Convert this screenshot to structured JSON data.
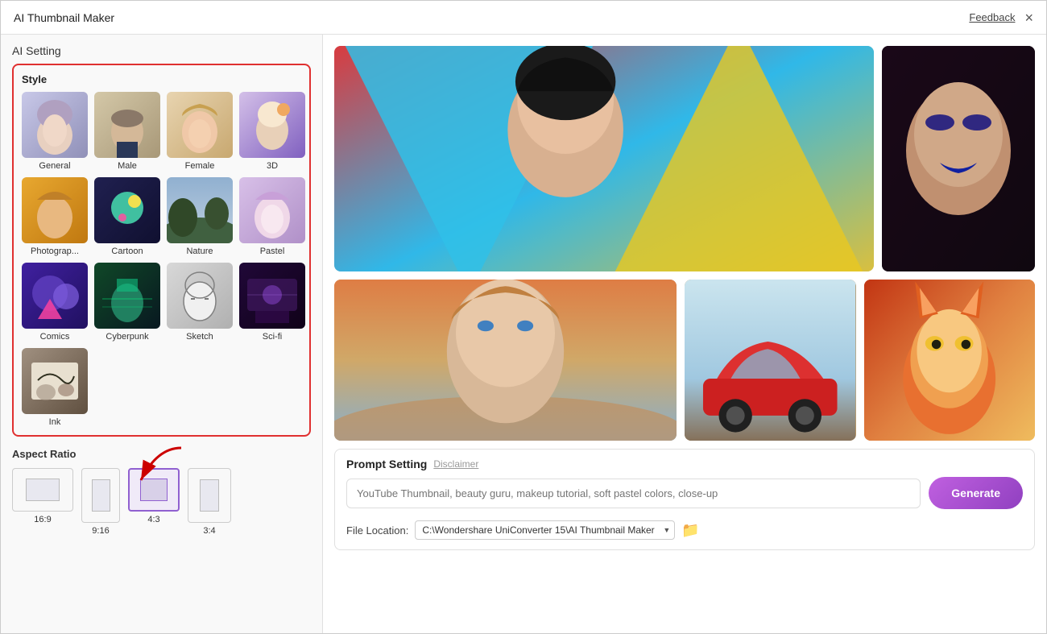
{
  "window": {
    "title": "AI Thumbnail Maker",
    "feedback_label": "Feedback",
    "close_icon": "×"
  },
  "left": {
    "ai_setting_title": "AI Setting",
    "style_section_title": "Style",
    "styles": [
      {
        "id": "general",
        "label": "General",
        "color_a": "#c8c8e8",
        "color_b": "#9090c0"
      },
      {
        "id": "male",
        "label": "Male",
        "color_a": "#d4c8a8",
        "color_b": "#a89878"
      },
      {
        "id": "female",
        "label": "Female",
        "color_a": "#e8d4b0",
        "color_b": "#c8a870"
      },
      {
        "id": "3d",
        "label": "3D",
        "color_a": "#d4c0e8",
        "color_b": "#8060c0"
      },
      {
        "id": "photography",
        "label": "Photograp...",
        "color_a": "#e8a830",
        "color_b": "#c07810"
      },
      {
        "id": "cartoon",
        "label": "Cartoon",
        "color_a": "#404080",
        "color_b": "#204060"
      },
      {
        "id": "nature",
        "label": "Nature",
        "color_a": "#607890",
        "color_b": "#304860"
      },
      {
        "id": "pastel",
        "label": "Pastel",
        "color_a": "#d8c0e8",
        "color_b": "#b090c8"
      },
      {
        "id": "comics",
        "label": "Comics",
        "color_a": "#4020a0",
        "color_b": "#201060"
      },
      {
        "id": "cyberpunk",
        "label": "Cyberpunk",
        "color_a": "#208040",
        "color_b": "#104828"
      },
      {
        "id": "sketch",
        "label": "Sketch",
        "color_a": "#b8b8c0",
        "color_b": "#909098"
      },
      {
        "id": "scifi",
        "label": "Sci-fi",
        "color_a": "#300848",
        "color_b": "#180228"
      },
      {
        "id": "ink",
        "label": "Ink",
        "color_a": "#807060",
        "color_b": "#504030"
      }
    ],
    "aspect_ratio_title": "Aspect Ratio",
    "aspect_ratios": [
      {
        "id": "16-9",
        "label": "16:9",
        "selected": false
      },
      {
        "id": "9-16",
        "label": "9:16",
        "selected": false
      },
      {
        "id": "4-3",
        "label": "4:3",
        "selected": true
      },
      {
        "id": "3-4",
        "label": "3:4",
        "selected": false
      }
    ]
  },
  "right": {
    "prompt_section": {
      "title": "Prompt Setting",
      "disclaimer_label": "Disclaimer",
      "input_placeholder": "YouTube Thumbnail, beauty guru, makeup tutorial, soft pastel colors, close-up",
      "generate_button_label": "Generate"
    },
    "file_location": {
      "label": "File Location:",
      "path": "C:\\Wondershare UniConverter 15\\AI Thumbnail Maker",
      "folder_icon": "📁"
    }
  }
}
